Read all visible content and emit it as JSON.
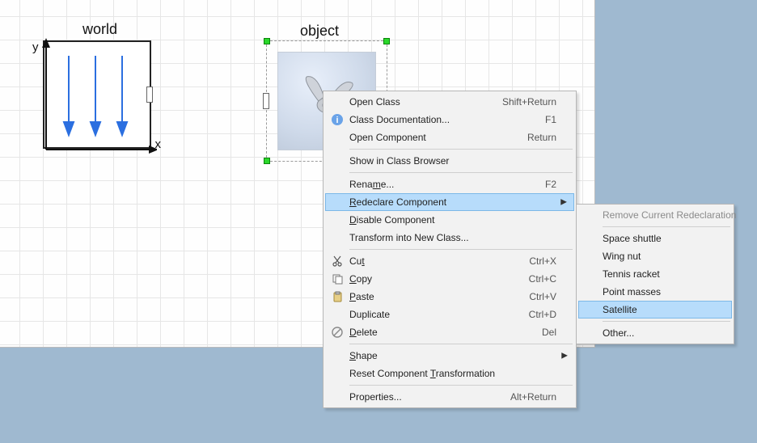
{
  "canvas": {
    "world": {
      "label": "world",
      "x_axis": "x",
      "y_axis": "y"
    },
    "object": {
      "label": "object"
    }
  },
  "context_menu": {
    "open_class": {
      "label": "Open Class",
      "shortcut": "Shift+Return"
    },
    "class_doc": {
      "label": "Class Documentation...",
      "shortcut": "F1"
    },
    "open_component": {
      "label": "Open Component",
      "shortcut": "Return"
    },
    "show_browser": {
      "label": "Show in Class Browser"
    },
    "rename": {
      "label_pre": "Rena",
      "mn": "m",
      "label_post": "e...",
      "shortcut": "F2"
    },
    "redeclare": {
      "label_pre": "",
      "mn": "R",
      "label_post": "edeclare Component"
    },
    "disable": {
      "label_pre": "",
      "mn": "D",
      "label_post": "isable Component"
    },
    "transform": {
      "label": "Transform into New Class..."
    },
    "cut": {
      "label_pre": "Cu",
      "mn": "t",
      "label_post": "",
      "shortcut": "Ctrl+X"
    },
    "copy": {
      "label_pre": "",
      "mn": "C",
      "label_post": "opy",
      "shortcut": "Ctrl+C"
    },
    "paste": {
      "label_pre": "",
      "mn": "P",
      "label_post": "aste",
      "shortcut": "Ctrl+V"
    },
    "duplicate": {
      "label": "Duplicate",
      "shortcut": "Ctrl+D"
    },
    "delete": {
      "label_pre": "",
      "mn": "D",
      "label_post": "elete",
      "shortcut": "Del"
    },
    "shape": {
      "label_pre": "",
      "mn": "S",
      "label_post": "hape"
    },
    "reset": {
      "label_pre": "Reset Component ",
      "mn": "T",
      "label_post": "ransformation"
    },
    "properties": {
      "label": "Properties...",
      "shortcut": "Alt+Return"
    }
  },
  "submenu": {
    "remove": {
      "label": "Remove Current Redeclaration"
    },
    "space_shuttle": {
      "label": "Space shuttle"
    },
    "wing_nut": {
      "label": "Wing nut"
    },
    "tennis_racket": {
      "label": "Tennis racket"
    },
    "point_masses": {
      "label": "Point masses"
    },
    "satellite": {
      "label": "Satellite"
    },
    "other": {
      "label": "Other..."
    }
  }
}
